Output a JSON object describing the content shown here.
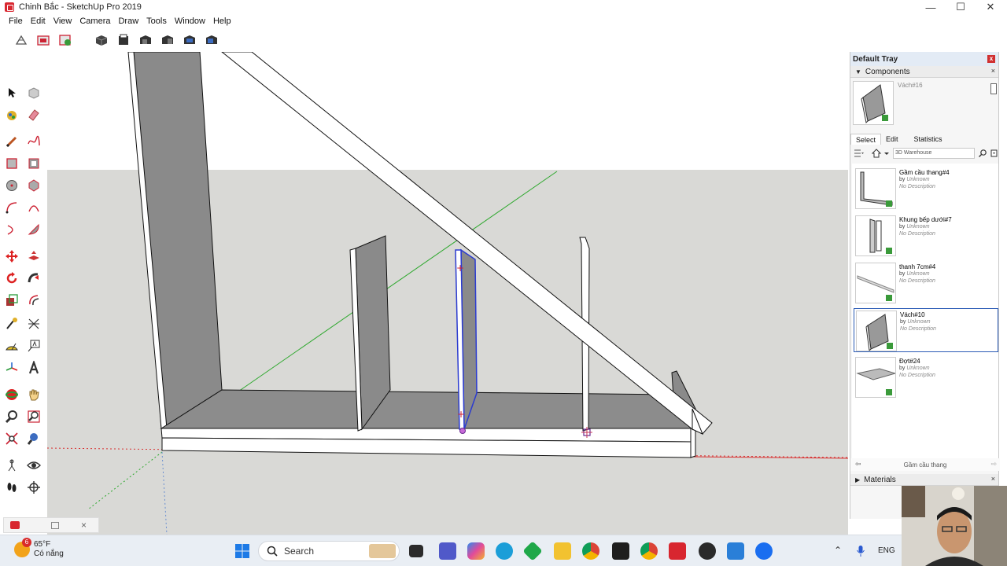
{
  "window": {
    "title": "Chinh Bắc - SketchUp Pro 2019",
    "minimize": "—",
    "maximize": "☐",
    "close": "✕"
  },
  "menu": [
    "File",
    "Edit",
    "View",
    "Camera",
    "Draw",
    "Tools",
    "Window",
    "Help"
  ],
  "tray": {
    "title": "Default Tray",
    "close": "x",
    "components": {
      "header": "Components",
      "selected_name": "Vách#16",
      "tabs": [
        "Select",
        "Edit",
        "Statistics"
      ],
      "search_value": "3D Warehouse",
      "items": [
        {
          "name": "Gầm cầu thang#4",
          "by_label": "by",
          "author": "Unknown",
          "description": "No Description",
          "selected": false
        },
        {
          "name": "Khung bếp dưới#7",
          "by_label": "by",
          "author": "Unknown",
          "description": "No Description",
          "selected": false
        },
        {
          "name": "thanh 7cm#4",
          "by_label": "by",
          "author": "Unknown",
          "description": "No Description",
          "selected": false
        },
        {
          "name": "Vách#10",
          "by_label": "by",
          "author": "Unknown",
          "description": "No Description",
          "selected": true
        },
        {
          "name": "Đợt#24",
          "by_label": "by",
          "author": "Unknown",
          "description": "No Description",
          "selected": false
        }
      ],
      "collection_name": "Gầm cầu thang"
    },
    "materials": {
      "header": "Materials"
    }
  },
  "taskbar": {
    "weather_temp": "65°F",
    "weather_desc": "Có nắng",
    "weather_badge": "6",
    "search_label": "Search",
    "language": "ENG"
  },
  "colors": {
    "accent": "#2b5bb5",
    "axis_red": "#d83030",
    "axis_green": "#2ea82e",
    "sketchup_red": "#d8262f"
  }
}
